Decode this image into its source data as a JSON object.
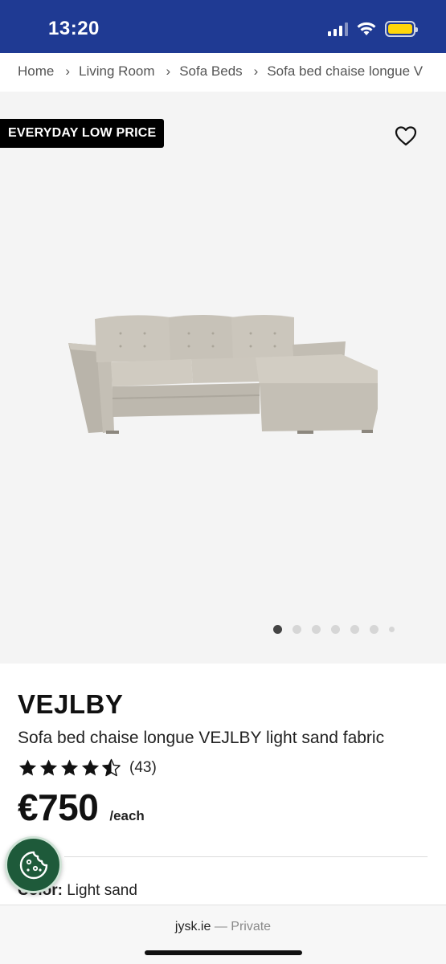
{
  "status_bar": {
    "time": "13:20"
  },
  "breadcrumb": {
    "items": [
      "Home",
      "Living Room",
      "Sofa Beds",
      "Sofa bed chaise longue V"
    ],
    "separator": "›"
  },
  "gallery": {
    "badge": "EVERYDAY LOW PRICE",
    "image_count": 7,
    "active_index": 0
  },
  "product": {
    "name": "VEJLBY",
    "description": "Sofa bed chaise longue VEJLBY light sand fabric",
    "rating": 4.5,
    "rating_max": 5,
    "review_count": "(43)",
    "price": "€750",
    "price_unit": "/each",
    "color_label": "Color:",
    "color_value": "Light sand"
  },
  "browser": {
    "domain": "jysk.ie",
    "mode": "— Private"
  },
  "colors": {
    "status_bar_bg": "#1f3a93",
    "cookie_button_bg": "#1e5a3a",
    "badge_bg": "#000000"
  }
}
